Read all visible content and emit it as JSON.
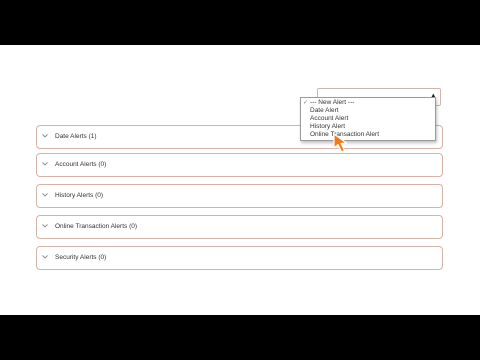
{
  "alert_select": {
    "selected": "--- New Alert ---",
    "options": [
      {
        "label": "--- New Alert ---",
        "checked": true
      },
      {
        "label": "Date Alert",
        "checked": false
      },
      {
        "label": "Account Alert",
        "checked": false
      },
      {
        "label": "History Alert",
        "checked": false
      },
      {
        "label": "Online Transaction Alert",
        "checked": false
      }
    ]
  },
  "sections": [
    {
      "label": "Date Alerts (1)"
    },
    {
      "label": "Account Alerts (0)"
    },
    {
      "label": "History Alerts (0)"
    },
    {
      "label": "Online Transaction Alerts (0)"
    },
    {
      "label": "Security Alerts (0)"
    }
  ],
  "colors": {
    "accordion_border": "#d3b3aa",
    "cursor": "#f07a1a",
    "background": "#ffffff"
  },
  "icons": {
    "accordion_toggle": "chevron-down-icon",
    "select_toggle": "triangle-up-icon",
    "option_check": "checkmark-icon",
    "pointer": "mouse-pointer-icon"
  }
}
